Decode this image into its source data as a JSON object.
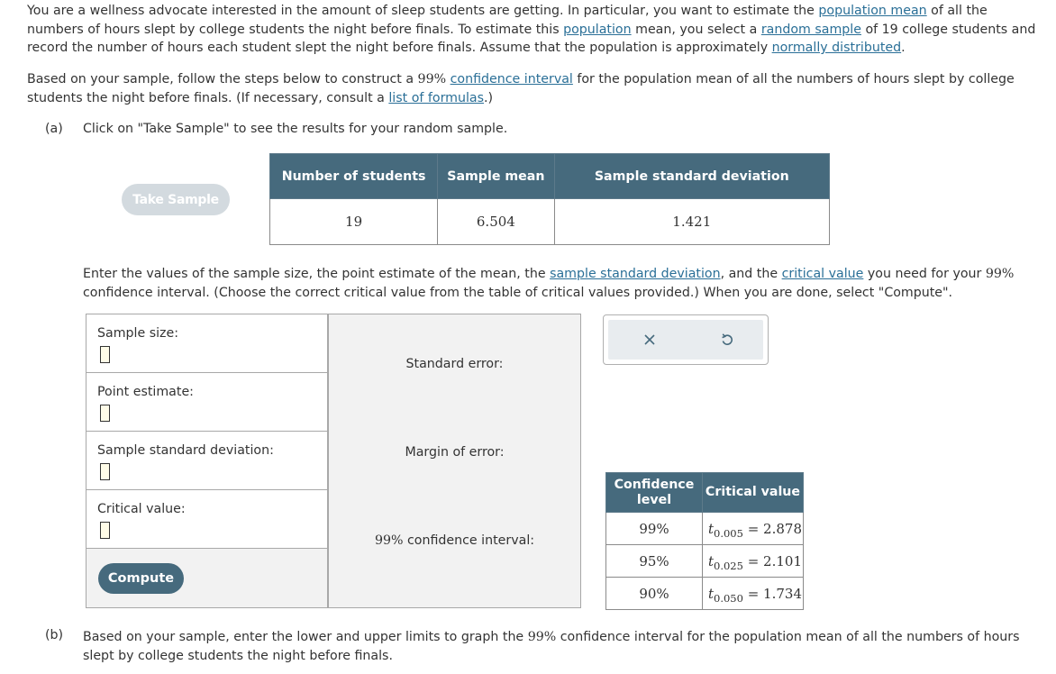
{
  "intro": {
    "t1": "You are a wellness advocate interested in the amount of sleep students are getting. In particular, you want to estimate the ",
    "link_population_mean": "population mean",
    "t2": " of all the numbers of hours slept by college students the night before finals. To estimate this ",
    "link_population": "population",
    "t3": " mean, you select a ",
    "link_random_sample": "random sample",
    "t4": " of 19 college students and record the number of hours each student slept the night before finals. Assume that the population is approximately ",
    "link_normally_distributed": "normally distributed",
    "t5": "."
  },
  "based": {
    "t1": "Based on your sample, follow the steps below to construct a ",
    "pct": "99%",
    "t2": " ",
    "link_confidence_interval": "confidence interval",
    "t3": " for the population mean of all the numbers of hours slept by college students the night before finals. (If necessary, consult a ",
    "link_list_of_formulas": "list of formulas",
    "t4": ".)"
  },
  "part_a": {
    "label": "(a)",
    "text": "Click on \"Take Sample\" to see the results for your random sample."
  },
  "take_sample_label": "Take Sample",
  "sample_table": {
    "headers": [
      "Number of students",
      "Sample mean",
      "Sample standard deviation"
    ],
    "values": [
      "19",
      "6.504",
      "1.421"
    ]
  },
  "enter": {
    "t1": "Enter the values of the sample size, the point estimate of the mean, the ",
    "link_sample_sd": "sample standard deviation",
    "t2": ", and the ",
    "link_critical_value": "critical value",
    "t3": " you need for your ",
    "pct": "99%",
    "t4": " confidence interval. (Choose the correct critical value from the table of critical values provided.) When you are done, select \"Compute\"."
  },
  "fields": {
    "sample_size": "Sample size:",
    "point_estimate": "Point estimate:",
    "sample_sd": "Sample standard deviation:",
    "critical_value": "Critical value:"
  },
  "compute_label": "Compute",
  "results": {
    "standard_error": "Standard error:",
    "margin_of_error": "Margin of error:",
    "ci_pct": "99%",
    "ci_label": " confidence interval:"
  },
  "crit_table": {
    "headers": [
      "Confidence level",
      "Critical value"
    ],
    "rows": [
      {
        "level": "99%",
        "t": "t",
        "sub": "0.005",
        "value": "= 2.878"
      },
      {
        "level": "95%",
        "t": "t",
        "sub": "0.025",
        "value": "= 2.101"
      },
      {
        "level": "90%",
        "t": "t",
        "sub": "0.050",
        "value": "= 1.734"
      }
    ]
  },
  "part_b": {
    "label": "(b)",
    "t1": "Based on your sample, enter the lower and upper limits to graph the ",
    "pct": "99%",
    "t2": " confidence interval for the population mean of all the numbers of hours slept by college students the night before finals."
  },
  "icons": {
    "clear": "x-icon",
    "undo": "undo-icon"
  },
  "colors": {
    "header_bg": "#466a7d",
    "link": "#2a6f97",
    "input_bg": "#fffce8",
    "panel_bg": "#f2f2f2"
  }
}
